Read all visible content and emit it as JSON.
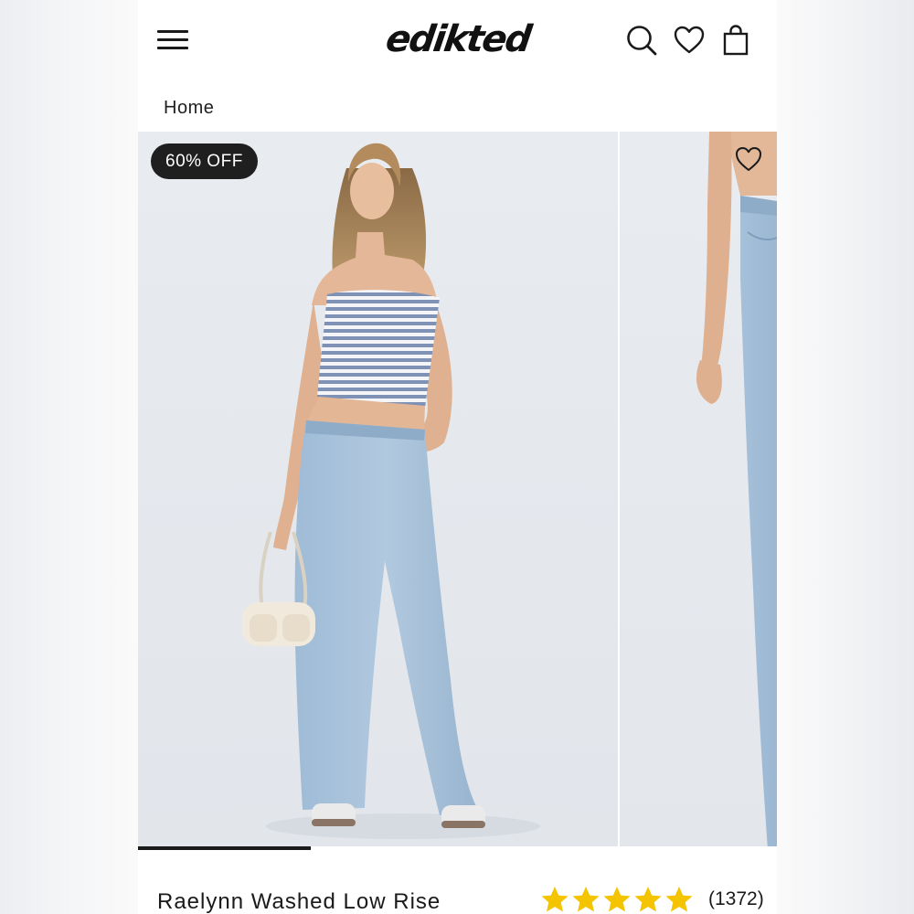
{
  "header": {
    "logo_text": "edikted",
    "icons": [
      "hamburger-menu-icon",
      "search-icon",
      "heart-icon",
      "shopping-bag-icon"
    ]
  },
  "breadcrumb": {
    "home_label": "Home"
  },
  "gallery": {
    "badge_label": "60% OFF",
    "current_slide_progress": 0.27
  },
  "product": {
    "title": "Raelynn Washed Low Rise",
    "rating_stars": 5,
    "review_count": "(1372)"
  },
  "colors": {
    "badge_bg": "#1f1f1f",
    "star": "#f5c400",
    "denim": "#a3bfd8",
    "background": "#e6eaee"
  }
}
